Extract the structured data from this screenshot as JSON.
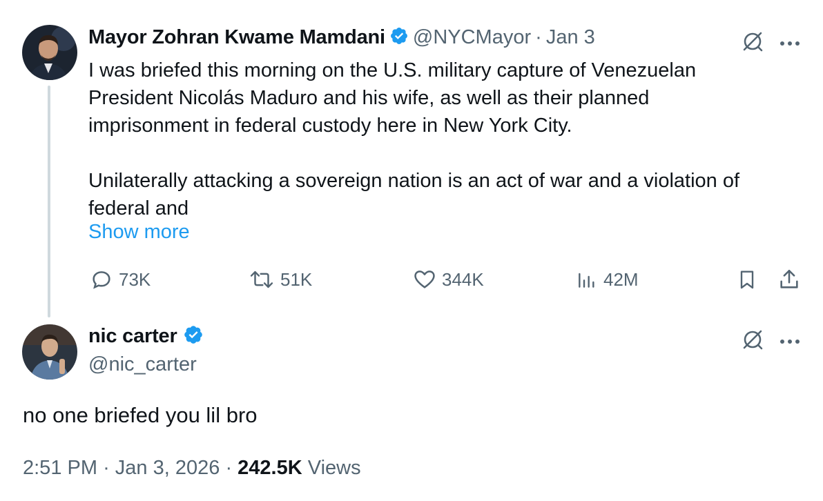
{
  "tweet1": {
    "name": "Mayor Zohran Kwame Mamdani",
    "handle": "@NYCMayor",
    "separator": "·",
    "date": "Jan 3",
    "lines": [
      "I was briefed this morning on the U.S. military capture of Venezuelan",
      "President Nicolás Maduro and his wife, as well as their planned",
      "imprisonment in federal custody here in New York City."
    ],
    "lines2": [
      "Unilaterally attacking a sovereign nation is an act of war and a violation of",
      "federal and"
    ],
    "show_more": "Show more",
    "stats": {
      "replies": "73K",
      "reposts": "51K",
      "likes": "344K",
      "views": "42M"
    }
  },
  "tweet2": {
    "name": "nic carter",
    "handle": "@nic_carter",
    "text": "no one briefed you lil bro",
    "time": "2:51 PM",
    "sep": "·",
    "date": "Jan 3, 2026",
    "views_count": "242.5K",
    "views_label": "Views"
  },
  "colors": {
    "accent": "#1d9bf0",
    "muted": "#536471",
    "text": "#0f1419",
    "line": "#cfd9de"
  },
  "icons": [
    "verified-badge-icon",
    "grok-icon",
    "more-icon",
    "reply-icon",
    "repost-icon",
    "like-icon",
    "views-icon",
    "bookmark-icon",
    "share-icon"
  ]
}
